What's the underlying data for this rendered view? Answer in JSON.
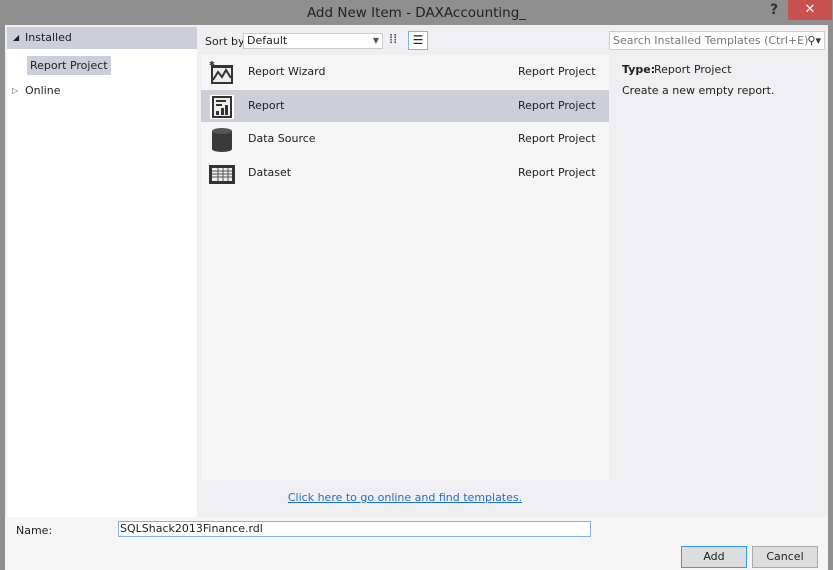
{
  "window": {
    "title": "Add New Item - DAXAccounting_",
    "help": "?",
    "close": "✕"
  },
  "tree": {
    "installed": "Installed",
    "report_project": "Report Project",
    "online": "Online"
  },
  "sort": {
    "label": "Sort by:",
    "value": "Default"
  },
  "search": {
    "placeholder": "Search Installed Templates (Ctrl+E)"
  },
  "items": [
    {
      "name": "Report Wizard",
      "category": "Report Project",
      "icon": "report-wizard-icon"
    },
    {
      "name": "Report",
      "category": "Report Project",
      "icon": "report-icon",
      "selected": true
    },
    {
      "name": "Data Source",
      "category": "Report Project",
      "icon": "data-source-icon"
    },
    {
      "name": "Dataset",
      "category": "Report Project",
      "icon": "dataset-icon"
    }
  ],
  "details": {
    "type_label": "Type:",
    "type_value": "Report Project",
    "description": "Create a new empty report."
  },
  "online_link": "Click here to go online and find templates.",
  "name": {
    "label": "Name:",
    "value": "SQLShack2013Finance.rdl"
  },
  "buttons": {
    "add": "Add",
    "cancel": "Cancel"
  }
}
